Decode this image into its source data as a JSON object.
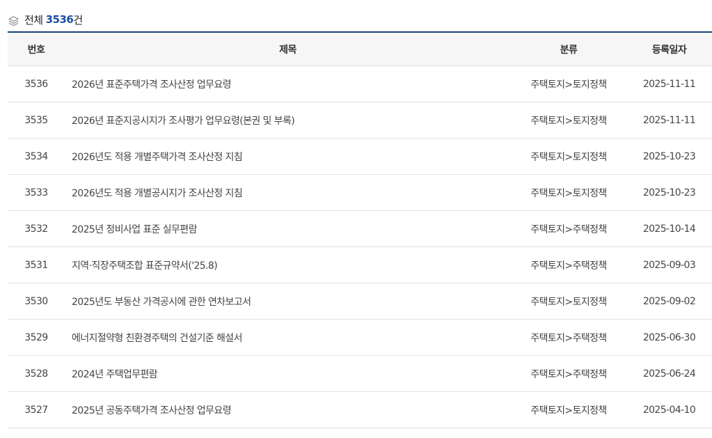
{
  "summary": {
    "label_prefix": "전체",
    "count": "3536",
    "label_suffix": "건"
  },
  "table": {
    "headers": {
      "no": "번호",
      "title": "제목",
      "category": "분류",
      "date": "등록일자"
    },
    "rows": [
      {
        "no": "3536",
        "title": "2026년 표준주택가격 조사산정 업무요령",
        "category": "주택토지>토지정책",
        "date": "2025-11-11"
      },
      {
        "no": "3535",
        "title": "2026년 표준지공시지가 조사평가 업무요령(본권 및 부록)",
        "category": "주택토지>토지정책",
        "date": "2025-11-11"
      },
      {
        "no": "3534",
        "title": "2026년도 적용 개별주택가격 조사산정 지침",
        "category": "주택토지>토지정책",
        "date": "2025-10-23"
      },
      {
        "no": "3533",
        "title": "2026년도 적용 개별공시지가 조사산정 지침",
        "category": "주택토지>토지정책",
        "date": "2025-10-23"
      },
      {
        "no": "3532",
        "title": "2025년 정비사업 표준 실무편람",
        "category": "주택토지>주택정책",
        "date": "2025-10-14"
      },
      {
        "no": "3531",
        "title": "지역·직장주택조합 표준규약서('25.8)",
        "category": "주택토지>주택정책",
        "date": "2025-09-03"
      },
      {
        "no": "3530",
        "title": "2025년도 부동산 가격공시에 관한 연차보고서",
        "category": "주택토지>토지정책",
        "date": "2025-09-02"
      },
      {
        "no": "3529",
        "title": "에너지절약형 친환경주택의 건설기준 해설서",
        "category": "주택토지>주택정책",
        "date": "2025-06-30"
      },
      {
        "no": "3528",
        "title": "2024년 주택업무편람",
        "category": "주택토지>주택정책",
        "date": "2025-06-24"
      },
      {
        "no": "3527",
        "title": "2025년 공동주택가격 조사산정 업무요령",
        "category": "주택토지>토지정책",
        "date": "2025-04-10"
      }
    ]
  }
}
